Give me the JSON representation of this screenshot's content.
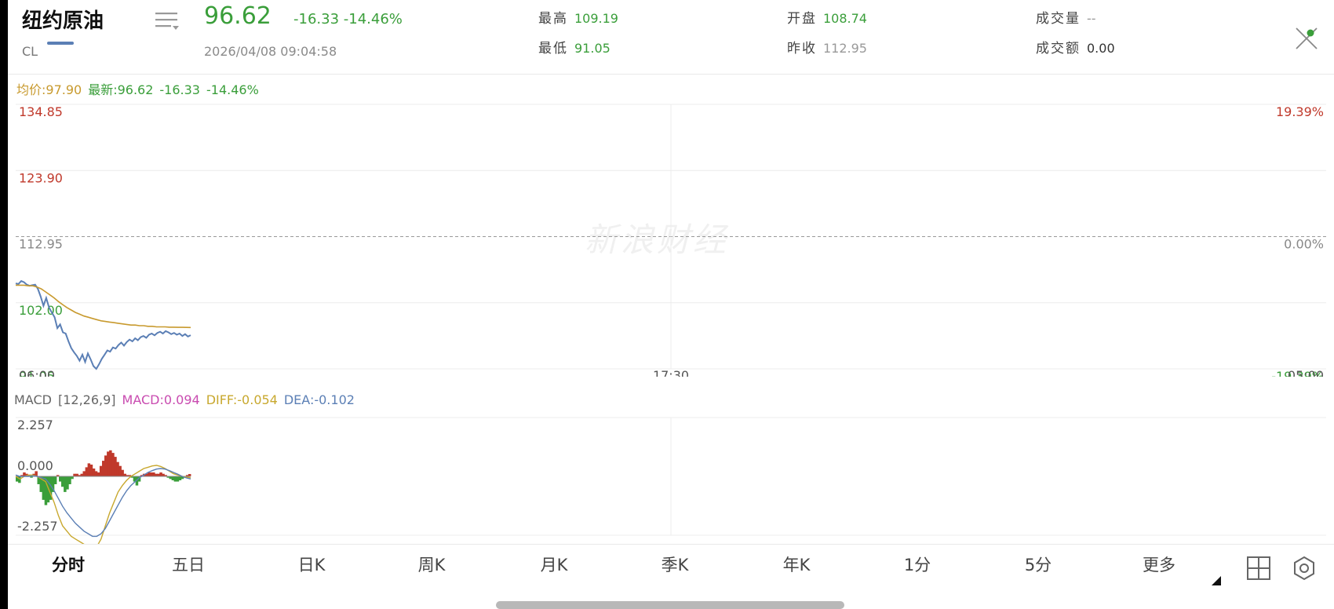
{
  "header": {
    "name": "纽约原油",
    "code": "CL",
    "price": "96.62",
    "change": "-16.33",
    "change_pct": "-14.46%",
    "timestamp": "2026/04/08 09:04:58",
    "stats": {
      "high_label": "最高",
      "high": "109.19",
      "low_label": "最低",
      "low": "91.05",
      "open_label": "开盘",
      "open": "108.74",
      "prev_close_label": "昨收",
      "prev_close": "112.95",
      "volume_label": "成交量",
      "volume": "--",
      "amount_label": "成交额",
      "amount": "0.00"
    }
  },
  "legend": {
    "avg": "均价:97.90",
    "last": "最新:96.62",
    "change": "-16.33",
    "change_pct": "-14.46%"
  },
  "watermark": "新浪财经",
  "colors": {
    "up": "#c0392b",
    "down": "#3a9e3a",
    "price_line": "#5b7fb5",
    "avg_line": "#c89a2e"
  },
  "chart_data": [
    {
      "type": "line",
      "title": "",
      "y_labels": [
        "134.85",
        "123.90",
        "112.95",
        "102.00",
        "91.05"
      ],
      "y_values": [
        134.85,
        123.9,
        112.95,
        102.0,
        91.05
      ],
      "pct_labels": [
        "19.39%",
        "0.00%",
        "-19.39%"
      ],
      "x_labels": [
        "06:00",
        "17:30",
        "05:00"
      ],
      "ylim": [
        91.05,
        134.85
      ],
      "prev_close": 112.95,
      "series": [
        {
          "name": "最新",
          "values": [
            105.2,
            105.1,
            105.6,
            105.4,
            105.0,
            104.8,
            104.9,
            105.0,
            104.3,
            103.0,
            101.5,
            102.8,
            101.2,
            100.4,
            99.6,
            97.8,
            98.4,
            97.1,
            96.9,
            95.6,
            94.5,
            93.8,
            93.2,
            92.4,
            93.4,
            92.2,
            93.6,
            92.6,
            91.5,
            91.05,
            91.8,
            92.7,
            93.4,
            94.1,
            93.9,
            94.6,
            94.4,
            95.0,
            95.4,
            94.9,
            95.5,
            95.9,
            95.6,
            96.1,
            95.8,
            96.3,
            96.5,
            96.2,
            96.7,
            96.9,
            96.6,
            97.0,
            97.2,
            96.9,
            97.3,
            97.1,
            96.8,
            97.0,
            96.7,
            96.9,
            96.5,
            96.8,
            96.4,
            96.62
          ]
        },
        {
          "name": "均价",
          "values": [
            104.9,
            104.9,
            104.9,
            104.8,
            104.8,
            104.6,
            104.3,
            103.8,
            103.3,
            102.8,
            102.2,
            101.7,
            101.2,
            100.8,
            100.4,
            100.1,
            99.8,
            99.6,
            99.4,
            99.2,
            99.0,
            98.9,
            98.8,
            98.7,
            98.6,
            98.5,
            98.4,
            98.3,
            98.3,
            98.2,
            98.2,
            98.1,
            98.1,
            98.0,
            98.0,
            98.0,
            97.95,
            97.95,
            97.93,
            97.92,
            97.91,
            97.9
          ]
        }
      ]
    },
    {
      "type": "bar",
      "title": "MACD",
      "params": "[12,26,9]",
      "macd": "MACD:0.094",
      "diff": "DIFF:-0.054",
      "dea": "DEA:-0.102",
      "y_labels": [
        "2.257",
        "0.000",
        "-2.257"
      ],
      "ylim": [
        -2.257,
        2.257
      ],
      "series": [
        {
          "name": "MACD",
          "values": [
            -0.2,
            -0.25,
            0.05,
            0.15,
            0.1,
            0.05,
            -0.05,
            0.1,
            0.2,
            -0.3,
            -0.6,
            -0.9,
            -1.1,
            -1.0,
            -0.9,
            -0.6,
            -0.3,
            0.05,
            -0.2,
            -0.4,
            -0.6,
            -0.5,
            -0.3,
            -0.1,
            0.1,
            0.1,
            0.05,
            0.1,
            0.2,
            0.35,
            0.5,
            0.45,
            0.3,
            0.2,
            0.15,
            0.4,
            0.6,
            0.8,
            0.95,
            1.0,
            0.9,
            0.75,
            0.55,
            0.4,
            0.25,
            0.1,
            0.05,
            0.05,
            -0.05,
            -0.2,
            -0.35,
            -0.2,
            0.05,
            0.1,
            0.1,
            0.15,
            0.15,
            0.15,
            0.1,
            0.1,
            0.15,
            0.1,
            0.05,
            -0.05,
            -0.1,
            -0.15,
            -0.2,
            -0.2,
            -0.15,
            -0.1,
            -0.05,
            0.05,
            0.09
          ]
        },
        {
          "name": "DIFF",
          "values": [
            0.0,
            -0.1,
            0.0,
            0.05,
            0.05,
            0.0,
            -0.1,
            -0.2,
            -0.6,
            -1.0,
            -1.5,
            -1.9,
            -2.1,
            -2.3,
            -2.4,
            -2.5,
            -2.6,
            -2.8,
            -2.9,
            -2.7,
            -2.4,
            -1.9,
            -1.4,
            -1.0,
            -0.6,
            -0.35,
            -0.15,
            0.0,
            0.1,
            0.2,
            0.3,
            0.35,
            0.4,
            0.42,
            0.38,
            0.3,
            0.2,
            0.1,
            0.05,
            0.0,
            -0.03,
            -0.05
          ]
        },
        {
          "name": "DEA",
          "values": [
            0.05,
            0.0,
            0.0,
            0.0,
            0.02,
            0.0,
            -0.05,
            -0.1,
            -0.3,
            -0.55,
            -0.85,
            -1.15,
            -1.4,
            -1.6,
            -1.8,
            -1.95,
            -2.1,
            -2.2,
            -2.3,
            -2.3,
            -2.2,
            -2.0,
            -1.7,
            -1.4,
            -1.1,
            -0.8,
            -0.55,
            -0.35,
            -0.2,
            -0.05,
            0.05,
            0.15,
            0.22,
            0.28,
            0.3,
            0.28,
            0.22,
            0.15,
            0.08,
            0.0,
            -0.06,
            -0.1
          ]
        }
      ]
    }
  ],
  "tabs": [
    {
      "label": "分时",
      "active": true
    },
    {
      "label": "五日"
    },
    {
      "label": "日K"
    },
    {
      "label": "周K"
    },
    {
      "label": "月K"
    },
    {
      "label": "季K"
    },
    {
      "label": "年K"
    },
    {
      "label": "1分"
    },
    {
      "label": "5分"
    },
    {
      "label": "更多"
    }
  ],
  "icons": {
    "menu": "menu-lines-icon",
    "close": "close-icon",
    "grid": "grid-icon",
    "settings": "settings-hexagon-icon",
    "more_corner": "triangle-corner-icon"
  }
}
